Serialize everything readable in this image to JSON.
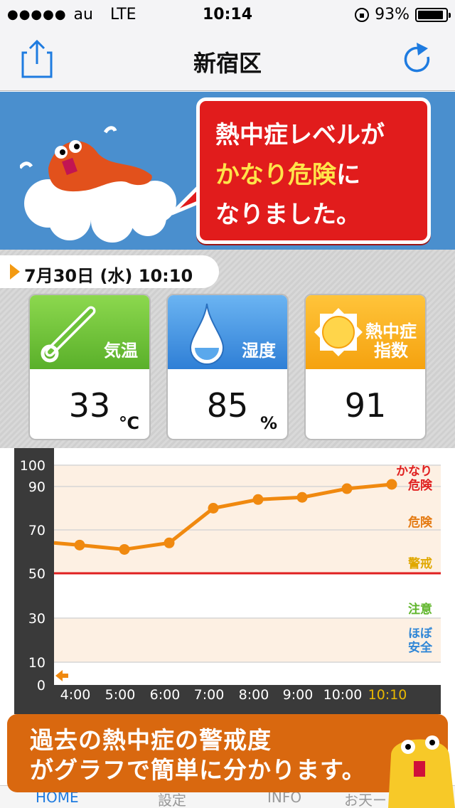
{
  "status_bar": {
    "carrier": "au",
    "network": "LTE",
    "time": "10:14",
    "battery": "93%",
    "battery_level": 0.93
  },
  "nav": {
    "title": "新宿区",
    "share_icon": "share-icon",
    "refresh_icon": "refresh-icon"
  },
  "banner": {
    "line1": "熱中症レベルが",
    "line2_highlight": "かなり危険",
    "line2_rest": "に",
    "line3": "なりました。",
    "accent": "#e11c1c"
  },
  "date": "7月30日 (水) 10:10",
  "cards": {
    "temperature": {
      "label": "気温",
      "value": "33",
      "unit": "℃"
    },
    "humidity": {
      "label": "湿度",
      "value": "85",
      "unit": "%"
    },
    "heat_index": {
      "label_line1": "熱中症",
      "label_line2": "指数",
      "value": "91"
    }
  },
  "chart_data": {
    "type": "line",
    "x": [
      "4:00",
      "5:00",
      "6:00",
      "7:00",
      "8:00",
      "9:00",
      "10:00",
      "10:10"
    ],
    "y_ticks": [
      "100",
      "90",
      "70",
      "50",
      "30",
      "10",
      "0"
    ],
    "series": [
      {
        "values": [
          63,
          61,
          64,
          80,
          84,
          85,
          89,
          91
        ]
      }
    ],
    "first_point_value": 64,
    "ylim": [
      0,
      100
    ],
    "threshold": {
      "value": 50,
      "color": "#e02020"
    },
    "zones": [
      {
        "label": "かなり\n危険",
        "color": "#e02020"
      },
      {
        "label": "危険",
        "color": "#e47a12"
      },
      {
        "label": "警戒",
        "color": "#e0a800"
      },
      {
        "label": "注意",
        "color": "#5fb52a"
      },
      {
        "label": "ほぼ\n安全",
        "color": "#2f86d6"
      }
    ],
    "line_color": "#f0890f"
  },
  "promo": {
    "line1": "過去の熱中症の警戒度",
    "line2": "がグラフで簡単に分かります。"
  },
  "tabs": [
    "HOME",
    "設定",
    "INFO",
    "お天ー"
  ]
}
